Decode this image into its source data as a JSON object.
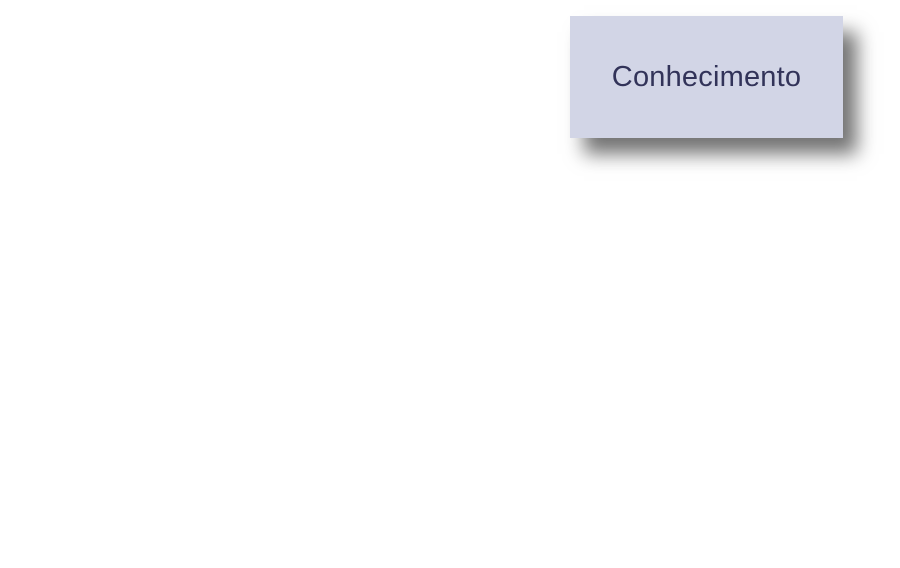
{
  "card": {
    "label": "Conhecimento",
    "background_color": "#d2d5e6",
    "text_color": "#323359"
  }
}
